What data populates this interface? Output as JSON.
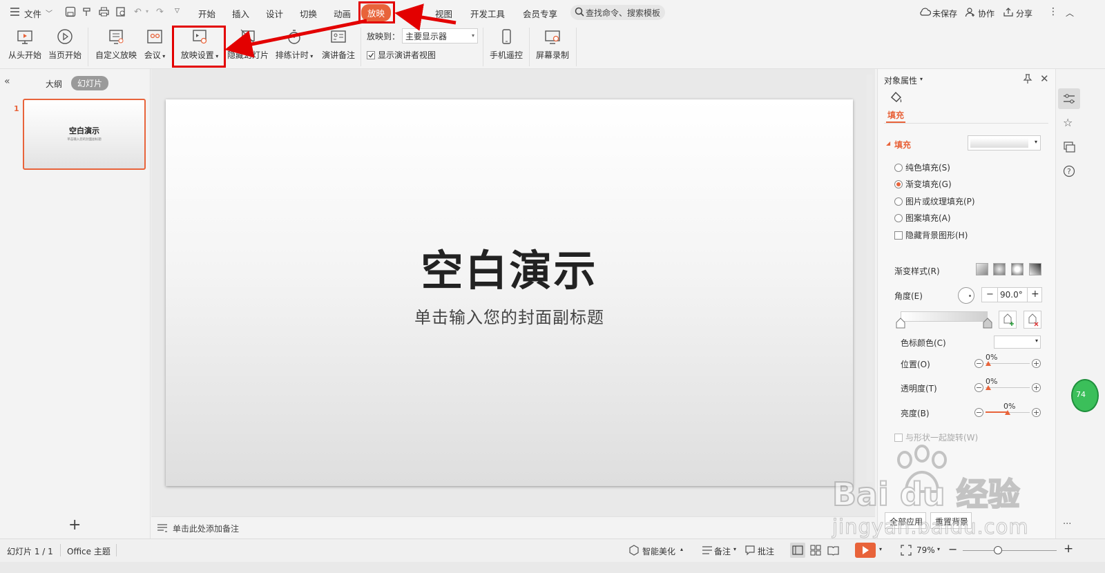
{
  "menubar": {
    "file_label": "文件",
    "tabs": [
      "开始",
      "插入",
      "设计",
      "切换",
      "动画",
      "放映",
      "审阅",
      "视图",
      "开发工具",
      "会员专享"
    ],
    "active_tab": "放映",
    "search_placeholder": "查找命令、搜索模板",
    "unsaved": "未保存",
    "collab": "协作",
    "share": "分享"
  },
  "ribbon": {
    "from_start": "从头开始",
    "from_current": "当页开始",
    "custom_show": "自定义放映",
    "meeting": "会议",
    "show_setup": "放映设置",
    "hide_slide": "隐藏幻灯片",
    "rehearse": "排练计时",
    "speaker_notes": "演讲备注",
    "play_to_label": "放映到：",
    "play_to_value": "主要显示器",
    "presenter_view": "显示演讲者视图",
    "phone_remote": "手机遥控",
    "screen_record": "屏幕录制"
  },
  "leftpane": {
    "outline_tab": "大纲",
    "slides_tab": "幻灯片",
    "slide_number": "1",
    "thumb_title": "空白演示",
    "thumb_subtitle": "单击输入您的封面副标题"
  },
  "slide": {
    "title": "空白演示",
    "subtitle": "单击输入您的封面副标题"
  },
  "notes_placeholder": "单击此处添加备注",
  "rpanel": {
    "header": "对象属性",
    "tab_fill": "填充",
    "section_fill": "填充",
    "options": [
      {
        "label": "纯色填充(S)",
        "checked": false
      },
      {
        "label": "渐变填充(G)",
        "checked": true
      },
      {
        "label": "图片或纹理填充(P)",
        "checked": false
      },
      {
        "label": "图案填充(A)",
        "checked": false
      }
    ],
    "hide_bg": "隐藏背景图形(H)",
    "gradient_style": "渐变样式(R)",
    "angle_label": "角度(E)",
    "angle_value": "90.0°",
    "stop_color": "色标颜色(C)",
    "position_label": "位置(O)",
    "position_value": "0%",
    "transparency_label": "透明度(T)",
    "transparency_value": "0%",
    "brightness_label": "亮度(B)",
    "brightness_value": "0%",
    "rotate_with_shape": "与形状一起旋转(W)",
    "apply_all": "全部应用",
    "reset_bg": "重置背景"
  },
  "statusbar": {
    "slide_info": "幻灯片 1 / 1",
    "theme": "Office 主题",
    "beautify": "智能美化",
    "notes": "备注",
    "comments": "批注",
    "zoom": "79%"
  },
  "watermark": {
    "brand": "Bai du 经验",
    "url": "jingyan.baidu.com"
  },
  "badge": "74",
  "colors": {
    "accent": "#e8633a",
    "annotation": "#e30000"
  }
}
